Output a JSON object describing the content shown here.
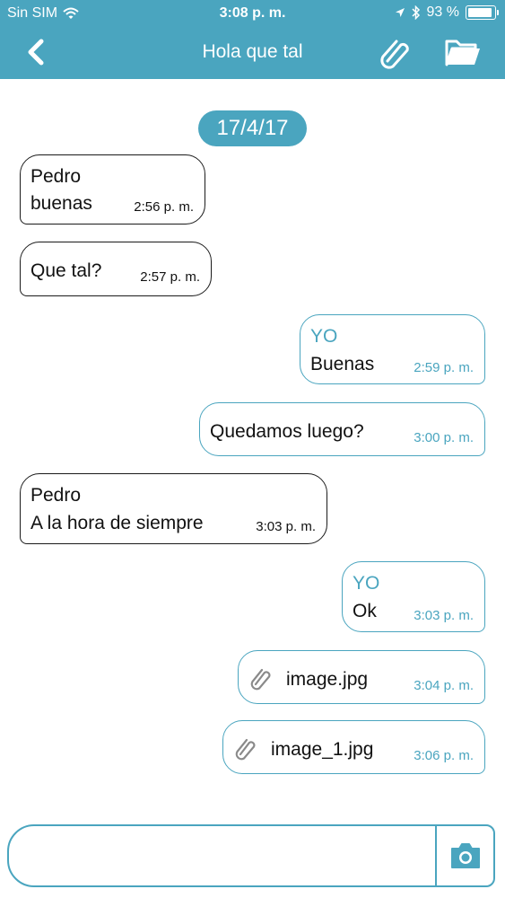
{
  "status_bar": {
    "carrier": "Sin SIM",
    "time": "3:08 p. m.",
    "battery": "93 %",
    "battery_level": 0.93
  },
  "nav": {
    "title": "Hola que tal",
    "back_icon": "chevron-left-icon",
    "attach_icon": "paperclip-icon",
    "folder_icon": "folder-icon"
  },
  "chat": {
    "date": "17/4/17",
    "messages": [
      {
        "direction": "in",
        "sender": "Pedro",
        "text": "buenas",
        "time": "2:56 p. m."
      },
      {
        "direction": "in",
        "sender": "",
        "text": "Que tal?",
        "time": "2:57 p. m."
      },
      {
        "direction": "out",
        "sender": "YO",
        "text": "Buenas",
        "time": "2:59 p. m."
      },
      {
        "direction": "out",
        "sender": "",
        "text": "Quedamos luego?",
        "time": "3:00 p. m."
      },
      {
        "direction": "in",
        "sender": "Pedro",
        "text": "A la hora de siempre",
        "time": "3:03 p. m."
      },
      {
        "direction": "out",
        "sender": "YO",
        "text": "Ok",
        "time": "3:03 p. m."
      },
      {
        "direction": "out",
        "attachment": true,
        "text": "image.jpg",
        "time": "3:04 p. m."
      },
      {
        "direction": "out",
        "attachment": true,
        "text": "image_1.jpg",
        "time": "3:06 p. m."
      }
    ]
  },
  "composer": {
    "value": "",
    "placeholder": "",
    "camera_icon": "camera-icon"
  },
  "colors": {
    "accent": "#4aa5bf",
    "incoming_border": "#1a1a1a",
    "background": "#ffffff"
  }
}
